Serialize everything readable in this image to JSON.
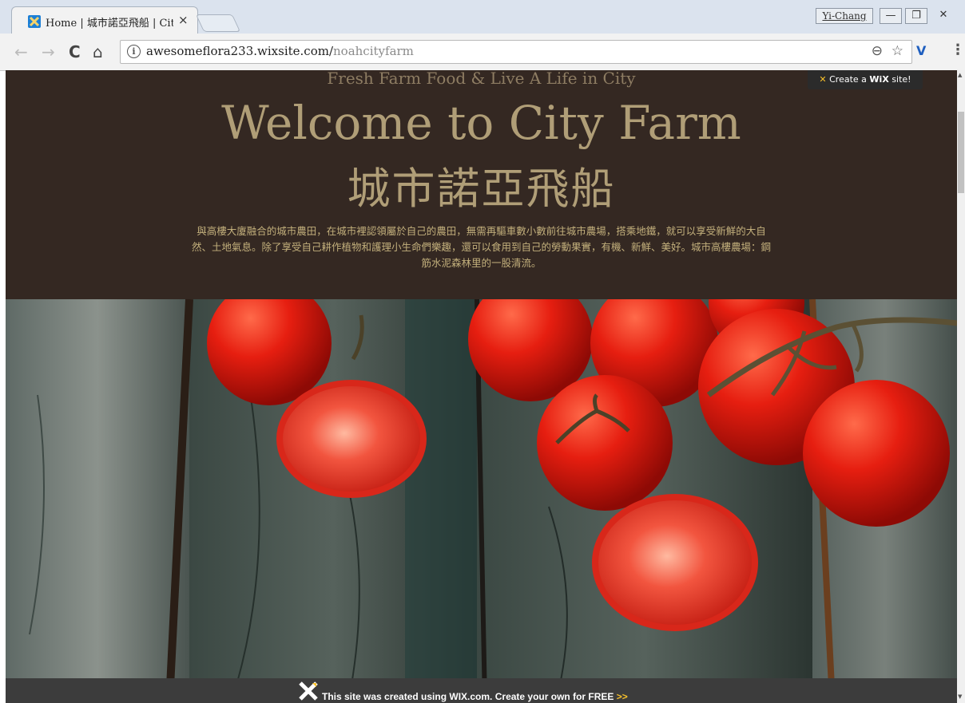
{
  "browser": {
    "tab_title": "Home | 城市諾亞飛船 | City Farm",
    "tab_close": "×",
    "user_name": "Yi-Chang",
    "window_minimize": "—",
    "window_restore": "❐",
    "window_close": "✕",
    "url_host": "awesomeflora233.wixsite.com/",
    "url_path": "noahcityfarm",
    "icons": [
      "back-icon",
      "forward-icon",
      "reload-icon",
      "home-icon",
      "info-icon",
      "zoom-icon",
      "star-icon",
      "extension-icon",
      "menu-icon"
    ]
  },
  "page": {
    "tagline": "Fresh Farm Food & Live A Life in City",
    "title": "Welcome to City Farm",
    "title_cn": "城市諾亞飛船",
    "description": "與高樓大廈融合的城市農田，在城市裡認領屬於自己的農田，無需再驅車數小數前往城市農場，搭乘地鐵，就可以享受新鮮的大自然、土地氣息。除了享受自己耕作植物和護理小生命們樂趣，還可以食用到自己的勞動果實，有機、新鮮、美好。城市高樓農場：鋼筋水泥森林里的一股清流。",
    "create_wix_prefix": "Create a",
    "create_wix_brand": "WiX",
    "create_wix_suffix": "site!"
  },
  "wix_banner": {
    "text": "This site was created using WIX.com. Create your own for FREE",
    "arrow": ">>"
  },
  "colors": {
    "hero_bg": "#342822",
    "title_gold": "#b09e77",
    "tagline": "#8e7d63",
    "description": "#c3b07c",
    "banner_bg": "#3c3c3c",
    "banner_accent": "#f9c12b"
  }
}
